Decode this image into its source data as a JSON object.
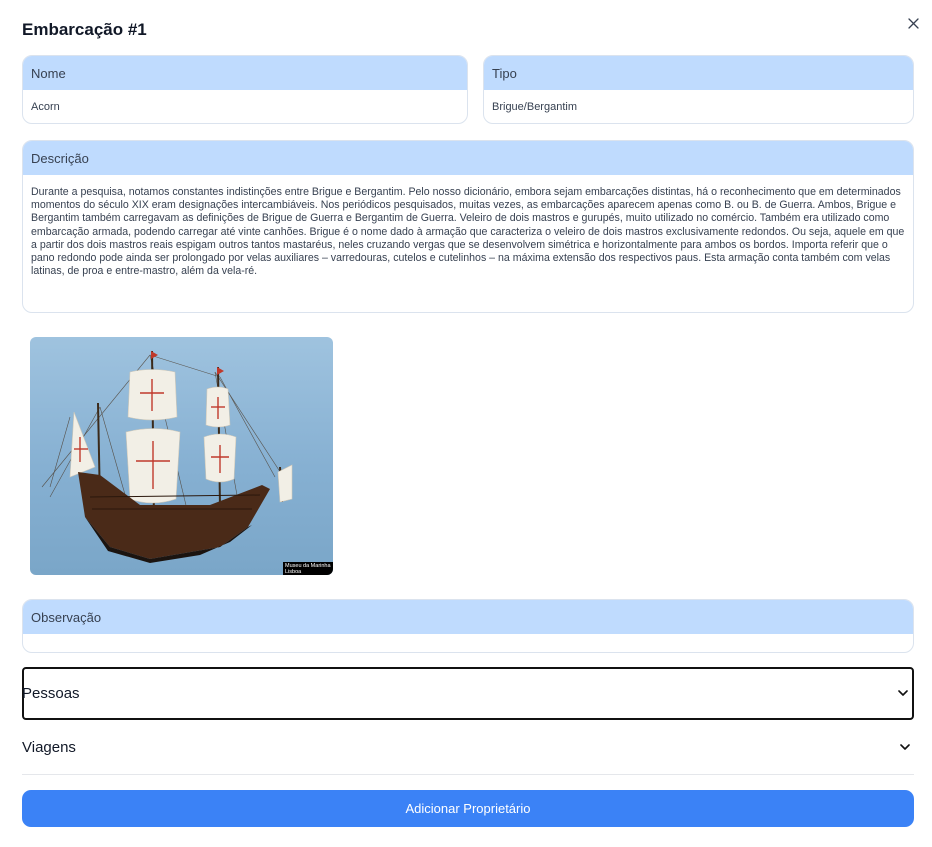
{
  "modal": {
    "title": "Embarcação #1",
    "close_icon": "close-icon"
  },
  "fields": {
    "nome": {
      "label": "Nome",
      "value": "Acorn"
    },
    "tipo": {
      "label": "Tipo",
      "value": "Brigue/Bergantim"
    },
    "descricao": {
      "label": "Descrição",
      "value": "Durante a pesquisa, notamos constantes indistinções entre Brigue e Bergantim. Pelo nosso dicionário, embora sejam embarcações distintas, há o reconhecimento que em determinados momentos do século XIX eram designações intercambiáveis. Nos periódicos pesquisados, muitas vezes, as embarcações aparecem apenas como B. ou B. de Guerra. Ambos, Brigue e Bergantim também carregavam as definições de Brigue de Guerra e Bergantim de Guerra. Veleiro de dois mastros e gurupés, muito utilizado no comércio. Também era utilizado como embarcação armada, podendo carregar até vinte canhões. Brigue é o nome dado à armação que caracteriza o veleiro de dois mastros exclusivamente redondos. Ou seja, aquele em que a partir dos dois mastros reais espigam outros tantos mastaréus, neles cruzando vergas que se desenvolvem simétrica e horizontalmente para ambos os bordos. Importa referir que o pano redondo pode ainda ser prolongado por velas auxiliares – varredouras, cutelos e cutelinhos – na máxima extensão dos respectivos paus. Esta armação conta também com velas latinas, de proa e entre-mastro, além da vela-ré."
    },
    "observacao": {
      "label": "Observação",
      "value": ""
    }
  },
  "image": {
    "caption_line1": "Museu da Marinha",
    "caption_line2": "Lisboa"
  },
  "accordions": [
    {
      "label": "Pessoas",
      "icon": "chevron-down-icon"
    },
    {
      "label": "Viagens",
      "icon": "chevron-down-icon"
    }
  ],
  "actions": {
    "add_owner_label": "Adicionar Proprietário"
  },
  "colors": {
    "header_bg": "#bfdbfe",
    "primary": "#3b82f6"
  }
}
